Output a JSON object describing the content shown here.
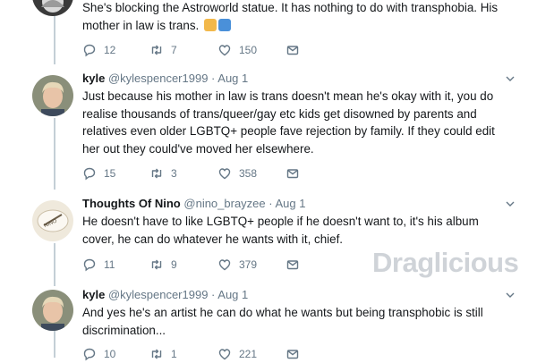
{
  "tweets": [
    {
      "text_lines": [
        "She's blocking the Astroworld statue. It has nothing to do with transphobia. His",
        "mother in law is trans."
      ],
      "emojis": [
        "woman-gesturing-emoji",
        "person-shrugging-emoji"
      ],
      "actions": {
        "replies": "12",
        "retweets": "7",
        "likes": "150"
      }
    },
    {
      "name": "kyle",
      "handle": "@kylespencer1999",
      "date": "· Aug 1",
      "text_lines": [
        "Just because his mother in law is trans doesn't mean he's okay with it, you do",
        "realise thousands of trans/queer/gay etc kids get disowned by parents and",
        "relatives even older LGBTQ+ people fave rejection by family. If they could edit",
        "her out they could've moved her elsewhere."
      ],
      "actions": {
        "replies": "15",
        "retweets": "3",
        "likes": "358"
      }
    },
    {
      "name": "Thoughts Of Nino",
      "handle": "@nino_brayzee",
      "date": "· Aug 1",
      "text_lines": [
        "He doesn't have to like LGBTQ+ people if he doesn't want to, it's his album",
        "cover, he can do whatever he wants with it, chief."
      ],
      "actions": {
        "replies": "11",
        "retweets": "9",
        "likes": "379"
      }
    },
    {
      "name": "kyle",
      "handle": "@kylespencer1999",
      "date": "· Aug 1",
      "text_lines": [
        "And yes he's an artist he can do what he wants but being transphobic is still",
        "discrimination..."
      ],
      "actions": {
        "replies": "10",
        "retweets": "1",
        "likes": "221"
      }
    }
  ],
  "watermark": "Draglicious",
  "colors": {
    "icon": "#657786",
    "thread": "#c4cfd6",
    "text": "#14171a"
  }
}
